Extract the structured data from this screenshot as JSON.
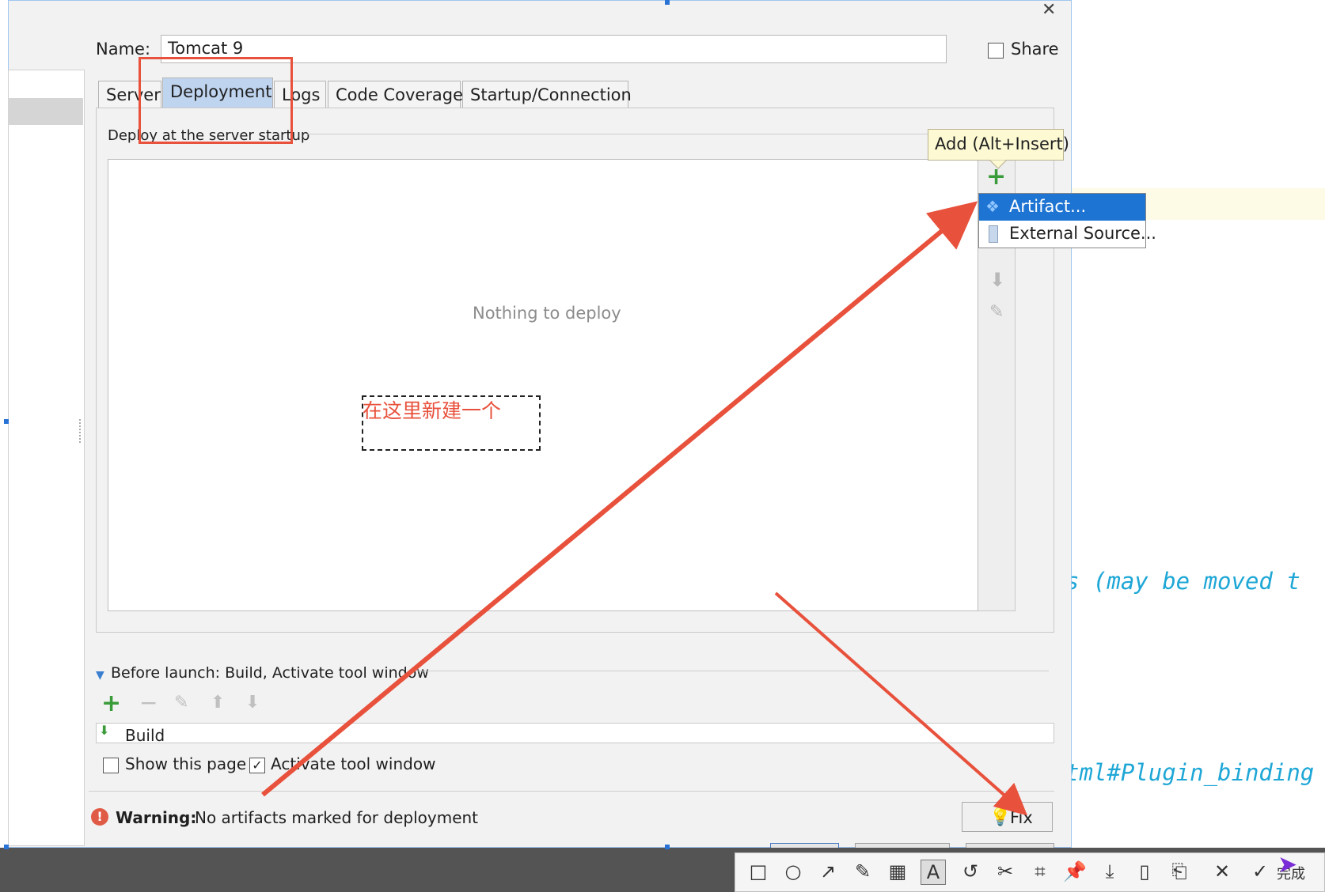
{
  "dialog": {
    "name_label": "Name:",
    "name_value": "Tomcat 9",
    "share_label": "Share",
    "tabs": [
      {
        "label": "Server"
      },
      {
        "label": "Deployment"
      },
      {
        "label": "Logs"
      },
      {
        "label": "Code Coverage"
      },
      {
        "label": "Startup/Connection"
      }
    ],
    "active_tab": "Deployment",
    "deploy_section_title": "Deploy at the server startup",
    "empty_text": "Nothing to deploy",
    "tooltip": "Add (Alt+Insert)",
    "add_menu": [
      {
        "label": "Artifact...",
        "icon": "artifact-icon",
        "selected": true
      },
      {
        "label": "External Source...",
        "icon": "external-source-icon",
        "selected": false
      }
    ],
    "before_launch_label": "Before launch: Build, Activate tool window",
    "build_task": "Build",
    "show_page_label": "Show this page",
    "show_page_checked": false,
    "activate_label": "Activate tool window",
    "activate_checked": true,
    "warning_bold": "Warning:",
    "warning_text": "No artifacts marked for deployment",
    "fix_label": "Fix"
  },
  "annotation": {
    "text": "在这里新建一个",
    "color": "#e8513c"
  },
  "editor_background": {
    "line1": "s (may be moved t",
    "line2": "tml#Plugin_binding"
  },
  "snip_toolbar": {
    "done_label": "完成",
    "tools": [
      "rectangle-tool-icon",
      "ellipse-tool-icon",
      "arrow-tool-icon",
      "pen-tool-icon",
      "mosaic-tool-icon",
      "text-tool-icon",
      "undo-icon",
      "cut-icon",
      "ocr-icon",
      "pin-icon",
      "download-icon",
      "phone-icon",
      "bookmark-icon",
      "close-icon",
      "check-icon"
    ]
  },
  "colors": {
    "accent_blue": "#1e74d2",
    "tab_active": "#bfd4ef",
    "tooltip_bg": "#fcf9d3",
    "annotation_red": "#e8513c",
    "add_green": "#3a9b3a"
  }
}
